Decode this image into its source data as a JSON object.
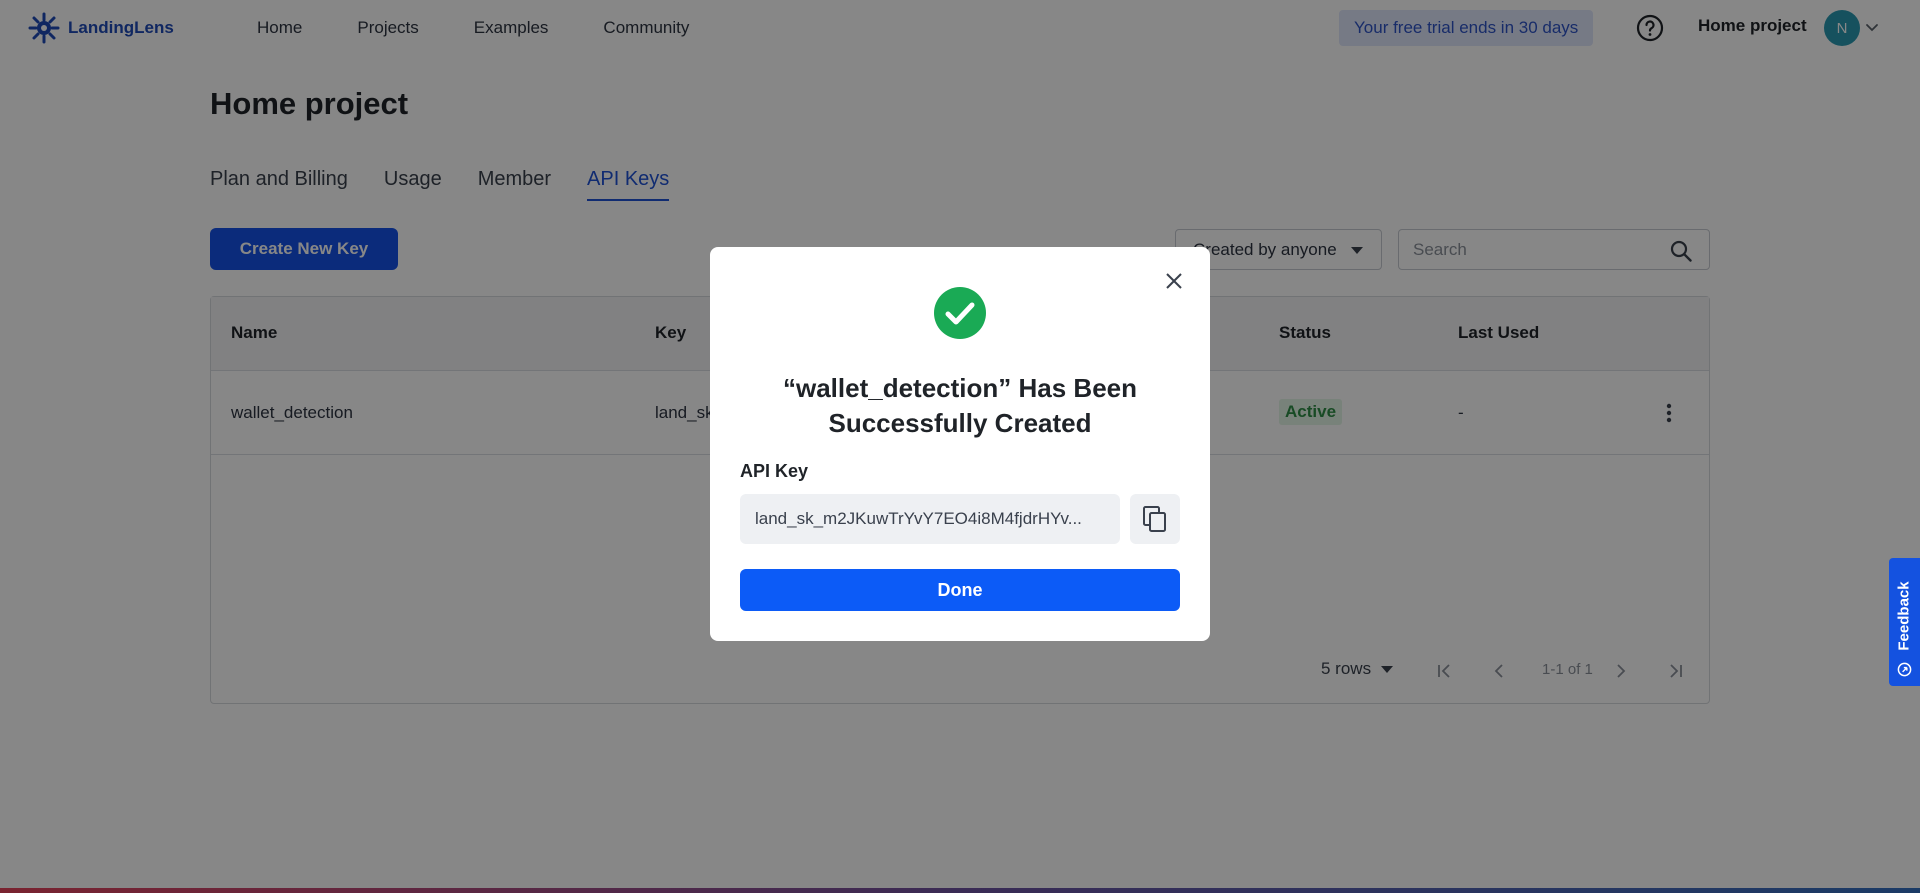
{
  "app": {
    "brand_name": "LandingLens",
    "nav": [
      {
        "label": "Home"
      },
      {
        "label": "Projects"
      },
      {
        "label": "Examples"
      },
      {
        "label": "Community"
      }
    ],
    "trial_notice": "Your free trial ends in 30 days",
    "project_name": "Home project",
    "avatar_initial": "N"
  },
  "page": {
    "title": "Home project",
    "tabs": [
      {
        "label": "Plan and Billing",
        "active": false
      },
      {
        "label": "Usage",
        "active": false
      },
      {
        "label": "Member",
        "active": false
      },
      {
        "label": "API Keys",
        "active": true
      }
    ],
    "create_button": "Create New Key",
    "filter_value": "Created by anyone",
    "search_placeholder": "Search"
  },
  "table": {
    "columns": [
      "Name",
      "Key",
      "Status",
      "Last Used"
    ],
    "rows": [
      {
        "name": "wallet_detection",
        "key": "land_sk",
        "status": "Active",
        "last_used": "-"
      }
    ],
    "pagination": {
      "rows_per_page": "5 rows",
      "range": "1-1 of 1"
    }
  },
  "modal": {
    "title": "“wallet_detection” Has Been Successfully Created",
    "api_key_label": "API Key",
    "api_key_value": "land_sk_m2JKuwTrYvY7EO4i8M4fjdrHYv...",
    "done_button": "Done"
  },
  "feedback_tab": "Feedback",
  "colors": {
    "primary": "#1552e8",
    "success": "#1aaa55",
    "badge_active": "#2f8f46",
    "trial_bg": "#dfe6fb"
  }
}
